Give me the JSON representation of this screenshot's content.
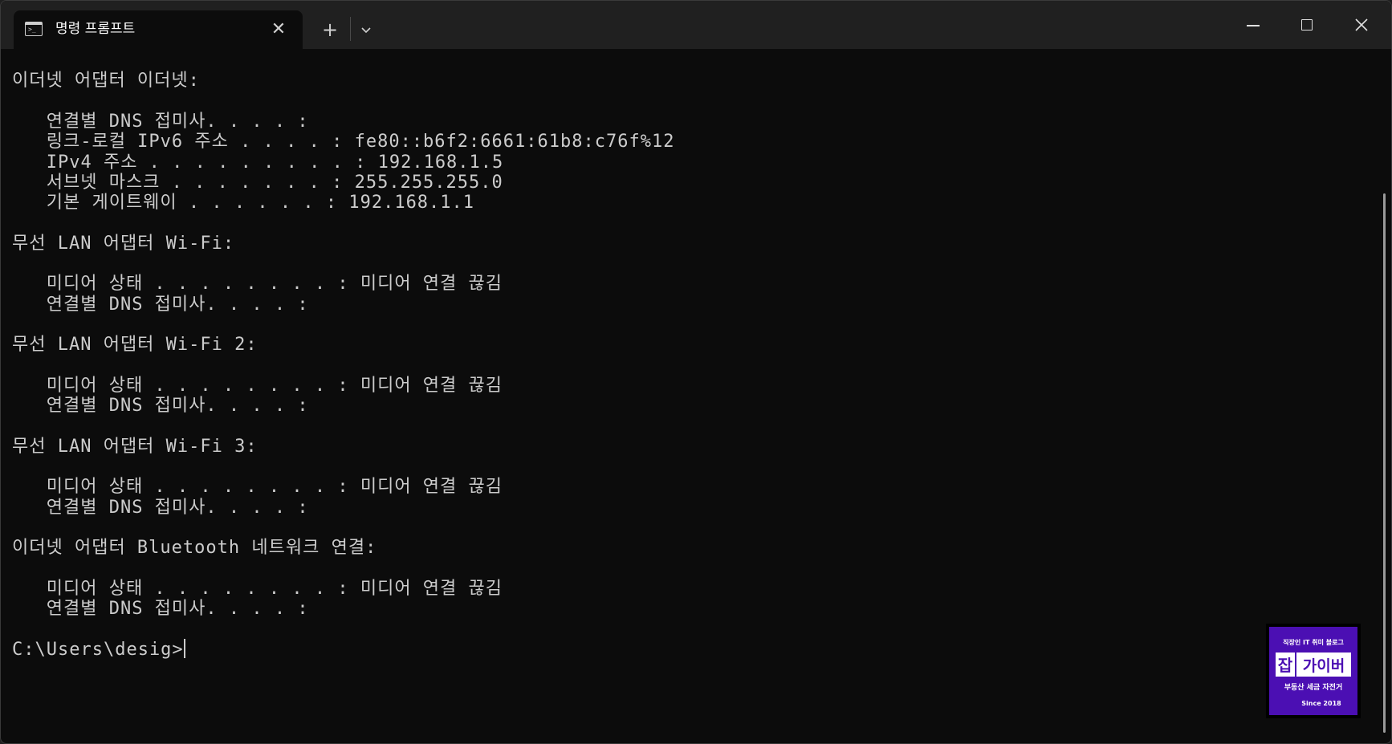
{
  "window": {
    "tab_title": "명령 프롬프트",
    "tab_close": "✕",
    "new_tab": "+",
    "icons": [
      "terminal-icon",
      "close-icon",
      "plus-icon",
      "chevron-down-icon",
      "minimize-icon",
      "maximize-icon",
      "close-window-icon"
    ]
  },
  "console": {
    "lines": [
      "",
      "이더넷 어댑터 이더넷:",
      "",
      "   연결별 DNS 접미사. . . . :",
      "   링크-로컬 IPv6 주소 . . . . : fe80::b6f2:6661:61b8:c76f%12",
      "   IPv4 주소 . . . . . . . . . : 192.168.1.5",
      "   서브넷 마스크 . . . . . . . : 255.255.255.0",
      "   기본 게이트웨이 . . . . . . : 192.168.1.1",
      "",
      "무선 LAN 어댑터 Wi-Fi:",
      "",
      "   미디어 상태 . . . . . . . . : 미디어 연결 끊김",
      "   연결별 DNS 접미사. . . . :",
      "",
      "무선 LAN 어댑터 Wi-Fi 2:",
      "",
      "   미디어 상태 . . . . . . . . : 미디어 연결 끊김",
      "   연결별 DNS 접미사. . . . :",
      "",
      "무선 LAN 어댑터 Wi-Fi 3:",
      "",
      "   미디어 상태 . . . . . . . . : 미디어 연결 끊김",
      "   연결별 DNS 접미사. . . . :",
      "",
      "이더넷 어댑터 Bluetooth 네트워크 연결:",
      "",
      "   미디어 상태 . . . . . . . . : 미디어 연결 끊김",
      "   연결별 DNS 접미사. . . . :",
      "",
      "C:\\Users\\desig>"
    ]
  },
  "watermark": {
    "top": "직장인 IT 취미 블로그",
    "big_left": "잡",
    "big_right": "가이버",
    "sub": "부동산 세금 자전거",
    "since": "Since 2018"
  },
  "colors": {
    "background": "#0c0c0c",
    "text": "#cccccc",
    "titlebar": "#202020",
    "logo": "#4b0fb3"
  }
}
